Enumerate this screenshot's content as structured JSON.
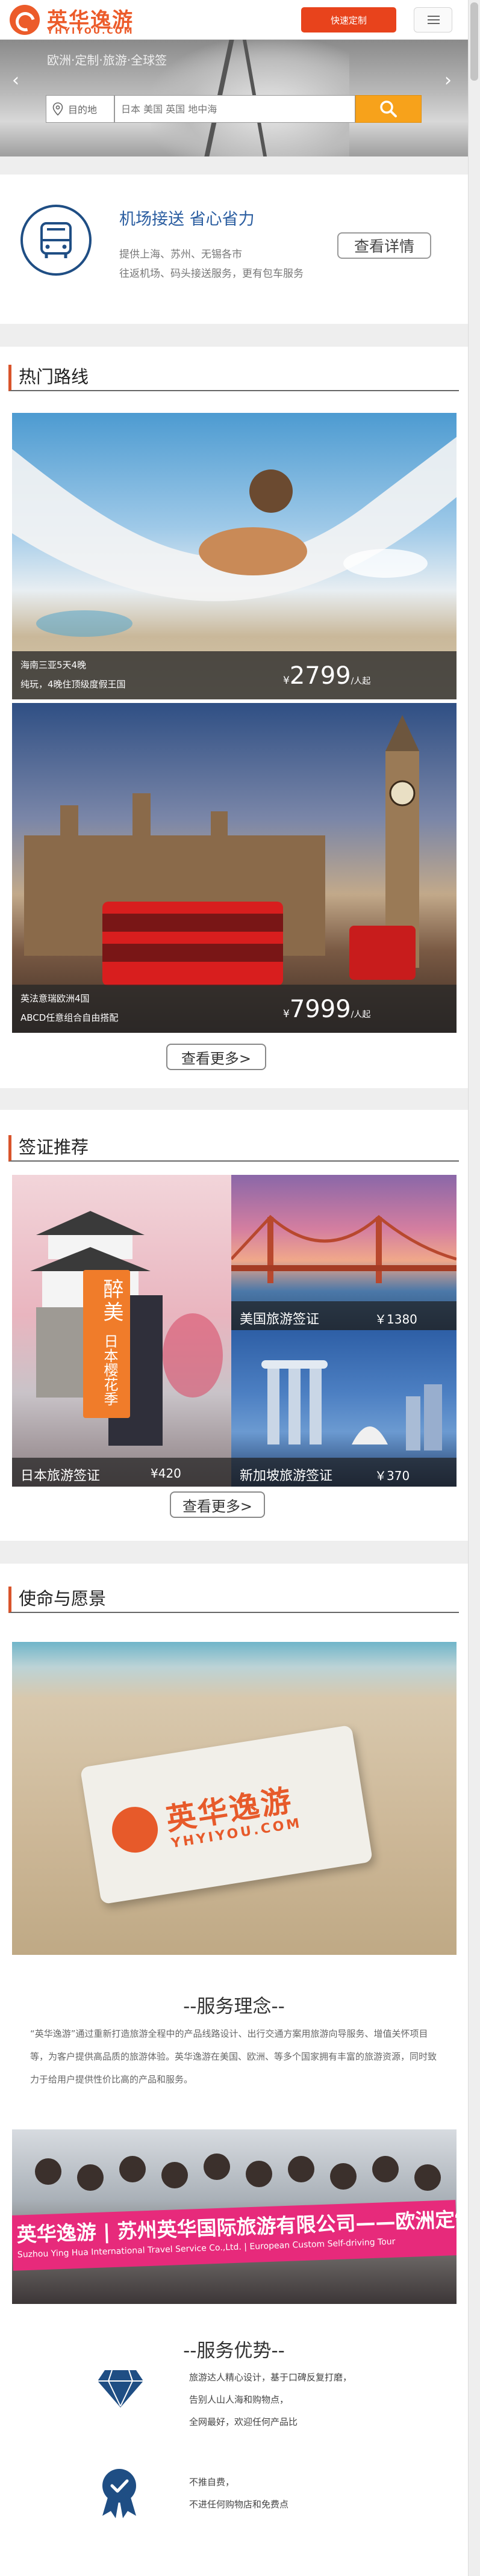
{
  "header": {
    "logo_cn": "英华逸游",
    "logo_en": "YHYIYOU.COM",
    "custom_button": "快速定制"
  },
  "banner": {
    "caption": "欧洲·定制·旅游·全球签",
    "city_label": "目的地",
    "search_placeholder": "日本 美国 英国 地中海"
  },
  "airport": {
    "title": "机场接送 省心省力",
    "line1": "提供上海、苏州、无锡各市",
    "line2": "往返机场、码头接送服务，更有包车服务",
    "detail_button": "查看详情"
  },
  "hot_routes": {
    "section_title": "热门路线",
    "routes": [
      {
        "name": "海南三亚5天4晚",
        "sub": "纯玩，4晚住顶级度假王国",
        "currency": "¥",
        "price": "2799",
        "unit": "/人起"
      },
      {
        "name": "英法意瑞欧洲4国",
        "sub": "ABCD任意组合自由搭配",
        "currency": "¥",
        "price": "7999",
        "unit": "/人起"
      }
    ],
    "more_button": "查看更多>"
  },
  "visa": {
    "section_title": "签证推荐",
    "japan": {
      "name": "日本旅游签证",
      "price": "¥420",
      "poster_big": "醉美",
      "poster_sub": "日本樱花季"
    },
    "usa": {
      "name": "美国旅游签证",
      "price": "￥1380"
    },
    "singapore": {
      "name": "新加坡旅游签证",
      "price": "￥370"
    },
    "more_button": "查看更多>"
  },
  "mission": {
    "section_title": "使命与愿景",
    "card_cn": "英华逸游",
    "card_en": "YHYIYOU.COM",
    "philosophy_title": "--服务理念--",
    "philosophy_text": "“英华逸游”通过重新打造旅游全程中的产品线路设计、出行交通方案用旅游向导服务、增值关怀项目等，为客户提供高品质的旅游体验。英华逸游在美国、欧洲、等多个国家拥有丰富的旅游资源，同时致力于给用户提供性价比高的产品和服务。",
    "team_banner_cn": "英华逸游 | 苏州英华国际旅游有限公司——欧洲定制自驾游",
    "team_banner_en": "Suzhou Ying Hua International Travel Service Co.,Ltd. | European Custom Self-driving Tour",
    "advantage_title": "--服务优势--",
    "advantages": [
      {
        "lines": [
          "旅游达人精心设计，基于口碑反复打磨，",
          "告别人山人海和购物点，",
          "全网最好，欢迎任何产品比"
        ]
      },
      {
        "lines": [
          "不推自费，",
          "不进任何购物店和免费点"
        ]
      }
    ]
  },
  "colors": {
    "brand_orange": "#ec5b2a",
    "button_red": "#e8431c",
    "search_orange": "#f7a21b",
    "airport_blue": "#1f4e84",
    "section_accent": "#d9542b",
    "team_pink": "#e72a7b"
  },
  "icons": [
    "logo-icon",
    "menu-icon",
    "location-pin-icon",
    "search-icon",
    "bus-icon",
    "diamond-icon",
    "ribbon-badge-icon",
    "chevron-left-icon",
    "chevron-right-icon"
  ]
}
